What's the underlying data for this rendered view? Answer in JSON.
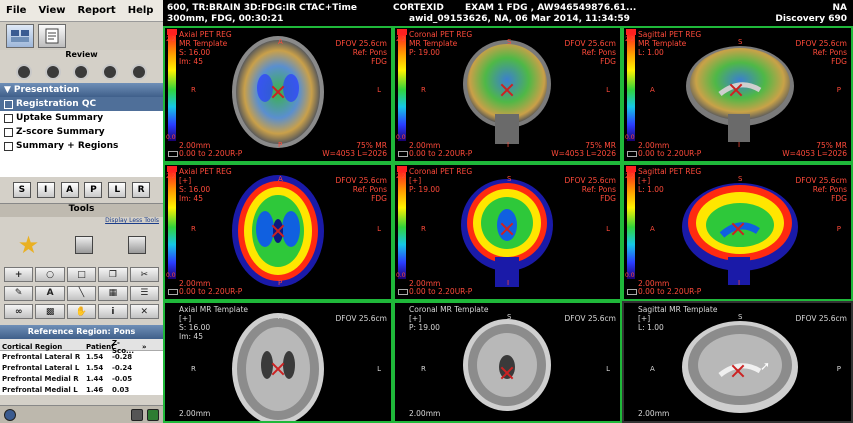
{
  "menu": [
    "File",
    "View",
    "Report",
    "Help"
  ],
  "review_label": "Review",
  "presentation": {
    "header": "Presentation",
    "items": [
      "Registration QC",
      "Uptake Summary",
      "Z-score Summary",
      "Summary + Regions"
    ],
    "selected_index": 0
  },
  "orientation_buttons": [
    "S",
    "I",
    "A",
    "P",
    "L",
    "R"
  ],
  "tools": {
    "header": "Tools",
    "less_link": "Display Less Tools",
    "text_tool": "A"
  },
  "reference_regions": {
    "header": "Reference Region: Pons",
    "columns": [
      "Cortical Region",
      "Patient",
      "Z-Sco..."
    ],
    "rows": [
      {
        "region": "Prefrontal Lateral R",
        "patient": "1.54",
        "z": "-0.28"
      },
      {
        "region": "Prefrontal Lateral L",
        "patient": "1.54",
        "z": "-0.24"
      },
      {
        "region": "Prefrontal Medial R",
        "patient": "1.44",
        "z": "-0.05"
      },
      {
        "region": "Prefrontal Medial L",
        "patient": "1.46",
        "z": "0.03"
      }
    ]
  },
  "study_info": {
    "line1_left": "600, TR:BRAIN 3D:FDG:IR CTAC+Time",
    "line2_left": "300mm, FDG, 00:30:21",
    "line1_center": "CORTEXID",
    "line1_exam": "EXAM 1  FDG  , AW946549876.61...",
    "line2_center": "awid_09153626, NA, 06 Mar 2014, 11:34:59",
    "line1_right": "NA",
    "line2_right": "Discovery 690"
  },
  "viewports": [
    {
      "title": "Axial PET REG",
      "sub": "MR Template",
      "coord": "S: 16.00",
      "extra": "Im: 45",
      "dfov": "DFOV 25.6cm",
      "ref": "Ref: Pons",
      "tracer": "FDG",
      "thickness": "2.00mm",
      "window": "0.00 to 2.20UR-P",
      "pct": "75% MR",
      "wl": "W=4053 L=2026",
      "top": "A",
      "bottom": "P",
      "left": "R",
      "right": "L",
      "cmax": "2.2",
      "cmin": "0.0"
    },
    {
      "title": "Coronal PET REG",
      "sub": "MR Template",
      "coord": "P: 19.00",
      "extra": "",
      "dfov": "DFOV 25.6cm",
      "ref": "Ref: Pons",
      "tracer": "FDG",
      "thickness": "2.00mm",
      "window": "0.00 to 2.20UR-P",
      "pct": "75% MR",
      "wl": "W=4053 L=2026",
      "top": "S",
      "bottom": "I",
      "left": "R",
      "right": "L",
      "cmax": "2.2",
      "cmin": "0.0"
    },
    {
      "title": "Sagittal PET REG",
      "sub": "MR Template",
      "coord": "L: 1.00",
      "extra": "",
      "dfov": "DFOV 25.6cm",
      "ref": "Ref: Pons",
      "tracer": "FDG",
      "thickness": "2.00mm",
      "window": "0.00 to 2.20UR-P",
      "pct": "75% MR",
      "wl": "W=4053 L=2026",
      "top": "S",
      "bottom": "I",
      "left": "A",
      "right": "P",
      "cmax": "2.2",
      "cmin": "0.0"
    },
    {
      "title": "Axial PET REG",
      "sub": "[+]",
      "coord": "S: 16.00",
      "extra": "Im: 45",
      "dfov": "DFOV 25.6cm",
      "ref": "Ref: Pons",
      "tracer": "FDG",
      "thickness": "2.00mm",
      "window": "0.00 to 2.20UR-P",
      "top": "A",
      "bottom": "P",
      "left": "R",
      "right": "L",
      "cmax": "2.2",
      "cmin": "0.0"
    },
    {
      "title": "Coronal PET REG",
      "sub": "[+]",
      "coord": "P: 19.00",
      "extra": "",
      "dfov": "DFOV 25.6cm",
      "ref": "Ref: Pons",
      "tracer": "FDG",
      "thickness": "2.00mm",
      "window": "0.00 to 2.20UR-P",
      "top": "S",
      "bottom": "I",
      "left": "R",
      "right": "L",
      "cmax": "2.2",
      "cmin": "0.0"
    },
    {
      "title": "Sagittal PET REG",
      "sub": "[+]",
      "coord": "L: 1.00",
      "extra": "",
      "dfov": "DFOV 25.6cm",
      "ref": "Ref: Pons",
      "tracer": "FDG",
      "thickness": "2.00mm",
      "window": "0.00 to 2.20UR-P",
      "top": "S",
      "bottom": "I",
      "left": "A",
      "right": "P",
      "cmax": "2.2",
      "cmin": "0.0"
    },
    {
      "title": "Axial MR Template",
      "sub": "[+]",
      "coord": "S: 16.00",
      "extra": "Im: 45",
      "dfov": "DFOV 25.6cm",
      "thickness": "2.00mm",
      "top": "A",
      "left": "R",
      "right": "L"
    },
    {
      "title": "Coronal MR Template",
      "sub": "[+]",
      "coord": "P: 19.00",
      "extra": "",
      "dfov": "DFOV 25.6cm",
      "thickness": "2.00mm",
      "top": "S",
      "left": "R",
      "right": "L"
    },
    {
      "title": "Sagittal MR Template",
      "sub": "[+]",
      "coord": "L: 1.00",
      "extra": "",
      "dfov": "DFOV 25.6cm",
      "thickness": "2.00mm",
      "top": "S",
      "left": "A",
      "right": "P"
    }
  ],
  "colors": {
    "viewport_active_border": "#1fb83a",
    "overlay_text": "#ff4a3a",
    "selection": "#4f6f99"
  }
}
